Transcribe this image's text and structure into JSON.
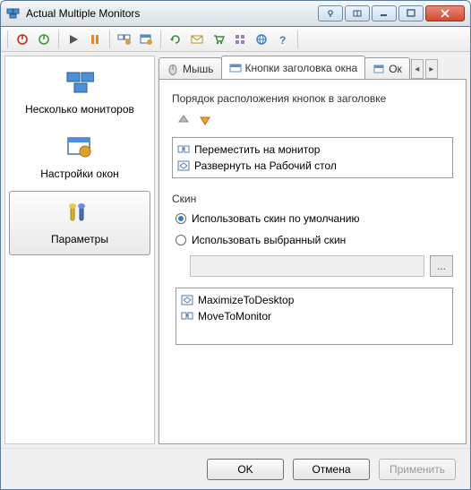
{
  "window": {
    "title": "Actual Multiple Monitors"
  },
  "sidebar": {
    "items": [
      {
        "label": "Несколько мониторов"
      },
      {
        "label": "Настройки окон"
      },
      {
        "label": "Параметры"
      }
    ]
  },
  "tabs": {
    "items": [
      {
        "label": "Мышь"
      },
      {
        "label": "Кнопки заголовка окна"
      },
      {
        "label": "Ок"
      }
    ]
  },
  "content": {
    "order_label": "Порядок расположения кнопок в заголовке",
    "buttons_list": [
      {
        "label": "Переместить на монитор"
      },
      {
        "label": "Развернуть на Рабочий стол"
      }
    ],
    "skin_label": "Скин",
    "radio_default": "Использовать скин по умолчанию",
    "radio_custom": "Использовать выбранный скин",
    "browse_label": "...",
    "skins_list": [
      {
        "label": "MaximizeToDesktop"
      },
      {
        "label": "MoveToMonitor"
      }
    ]
  },
  "footer": {
    "ok": "OK",
    "cancel": "Отмена",
    "apply": "Применить"
  }
}
